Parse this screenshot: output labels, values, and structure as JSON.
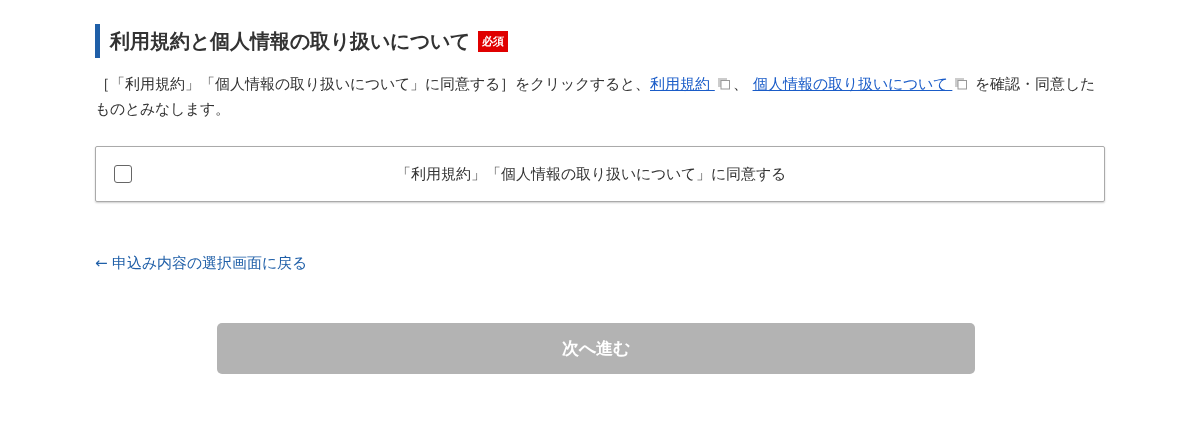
{
  "section": {
    "title": "利用規約と個人情報の取り扱いについて",
    "badge": "必須"
  },
  "notice": [
    {
      "kind": "text",
      "text": "［「利用規約」「個人情報の取り扱いについて」に同意する］をクリックすると、"
    },
    {
      "kind": "link",
      "text": "利用規約 "
    },
    {
      "kind": "text",
      "text": "、 "
    },
    {
      "kind": "link",
      "text": "個人情報の取り扱いについて "
    },
    {
      "kind": "text",
      "text": " を確認・同意したものとみなします。"
    }
  ],
  "agreement": {
    "label": "「利用規約」「個人情報の取り扱いについて」に同意する",
    "checked": false
  },
  "back_link": "← 申込み内容の選択画面に戻る",
  "next_button": {
    "label": "次へ進む",
    "disabled": true
  }
}
